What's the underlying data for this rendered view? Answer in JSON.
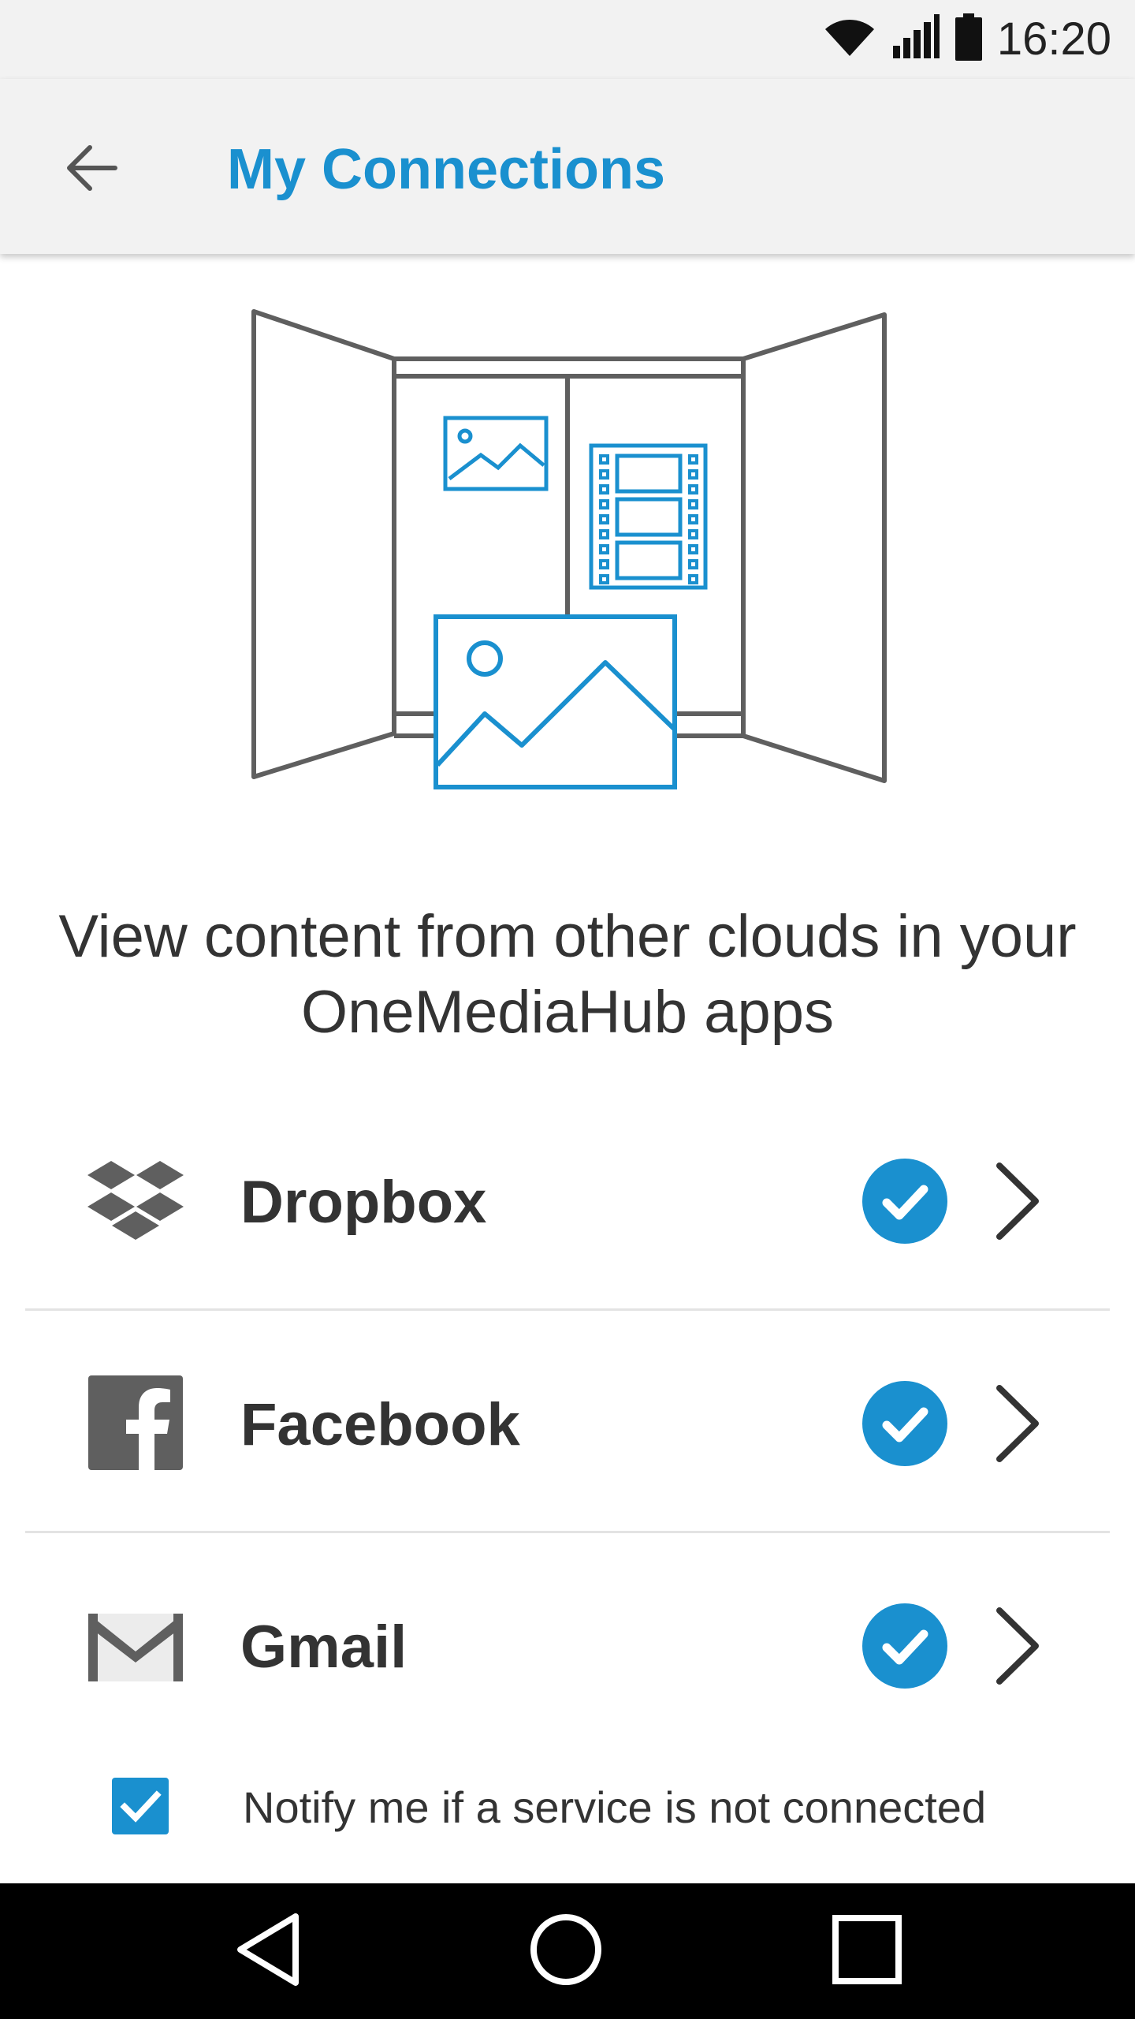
{
  "status_bar": {
    "time": "16:20",
    "icons": [
      "wifi-icon",
      "signal-icon",
      "battery-icon"
    ]
  },
  "app_bar": {
    "title": "My Connections",
    "back_icon": "arrow-left-icon"
  },
  "headline": "View content from other clouds in your OneMediaHub apps",
  "services": [
    {
      "name": "Dropbox",
      "icon": "dropbox-icon",
      "connected": true
    },
    {
      "name": "Facebook",
      "icon": "facebook-icon",
      "connected": true
    },
    {
      "name": "Gmail",
      "icon": "gmail-icon",
      "connected": true
    }
  ],
  "notify": {
    "label": "Notify me if a service is not connected",
    "checked": true
  },
  "nav": {
    "buttons": [
      "back-triangle-icon",
      "home-circle-icon",
      "recents-square-icon"
    ]
  },
  "colors": {
    "accent": "#1a90cf",
    "bar_background": "#f2f2f2",
    "text": "#333333",
    "icon_gray": "#5f5f5f"
  }
}
